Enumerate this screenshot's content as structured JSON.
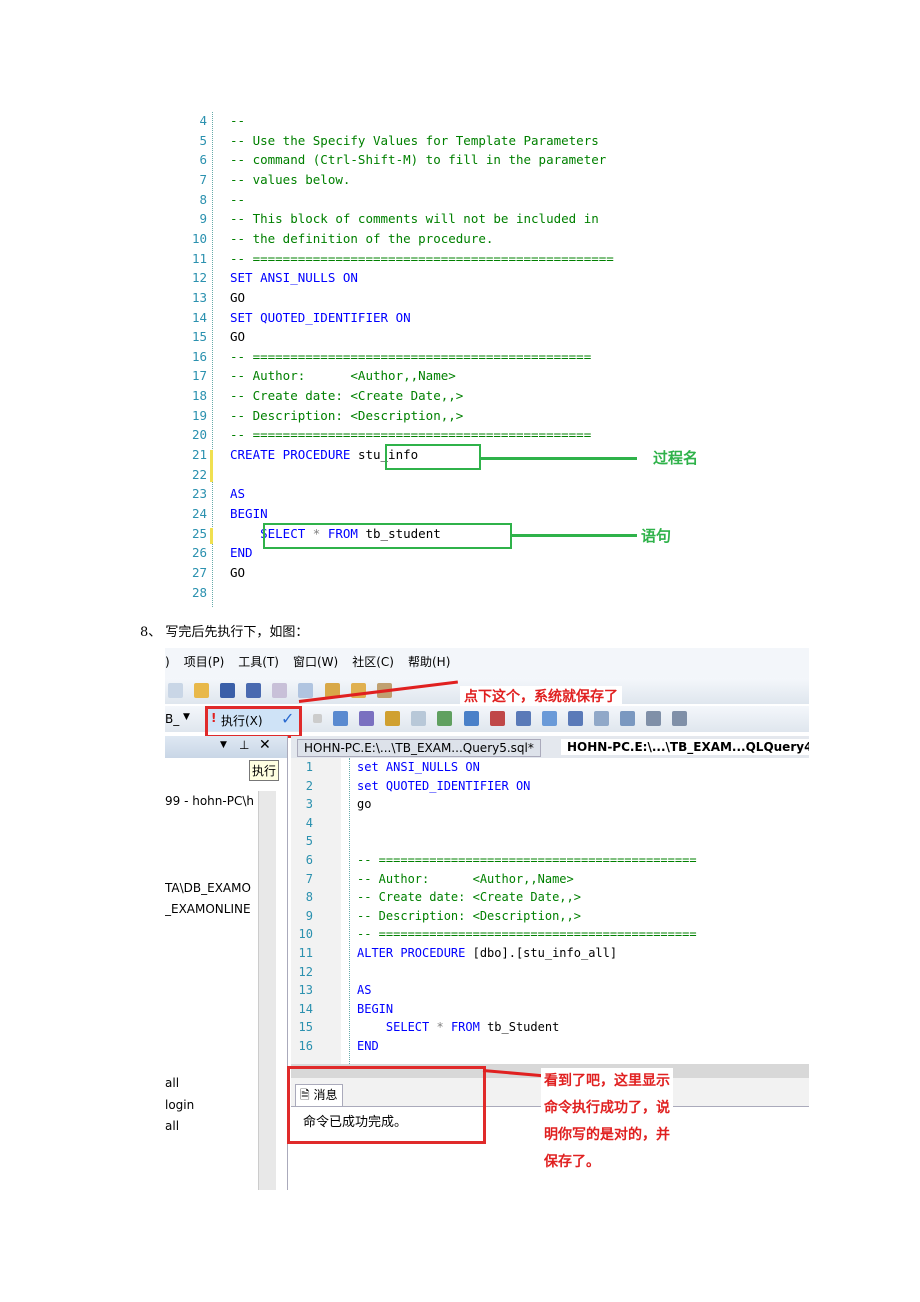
{
  "top_code": {
    "lines": [
      {
        "n": "4",
        "s": [
          {
            "t": "--",
            "c": "c"
          }
        ]
      },
      {
        "n": "5",
        "s": [
          {
            "t": "-- Use the Specify Values for Template Parameters",
            "c": "c"
          }
        ]
      },
      {
        "n": "6",
        "s": [
          {
            "t": "-- command (Ctrl-Shift-M) to fill in the parameter",
            "c": "c"
          }
        ]
      },
      {
        "n": "7",
        "s": [
          {
            "t": "-- values below.",
            "c": "c"
          }
        ]
      },
      {
        "n": "8",
        "s": [
          {
            "t": "--",
            "c": "c"
          }
        ]
      },
      {
        "n": "9",
        "s": [
          {
            "t": "-- This block of comments will not be included in",
            "c": "c"
          }
        ]
      },
      {
        "n": "10",
        "s": [
          {
            "t": "-- the definition of the procedure.",
            "c": "c"
          }
        ]
      },
      {
        "n": "11",
        "s": [
          {
            "t": "-- ================================================",
            "c": "c"
          }
        ]
      },
      {
        "n": "12",
        "s": [
          {
            "t": "SET ANSI_NULLS ON",
            "c": "k"
          }
        ]
      },
      {
        "n": "13",
        "s": [
          {
            "t": "GO",
            "c": "t"
          }
        ]
      },
      {
        "n": "14",
        "s": [
          {
            "t": "SET QUOTED_IDENTIFIER ON",
            "c": "k"
          }
        ]
      },
      {
        "n": "15",
        "s": [
          {
            "t": "GO",
            "c": "t"
          }
        ]
      },
      {
        "n": "16",
        "s": [
          {
            "t": "-- =============================================",
            "c": "c"
          }
        ]
      },
      {
        "n": "17",
        "s": [
          {
            "t": "-- Author:      <Author,,Name>",
            "c": "c"
          }
        ]
      },
      {
        "n": "18",
        "s": [
          {
            "t": "-- Create date: <Create Date,,>",
            "c": "c"
          }
        ]
      },
      {
        "n": "19",
        "s": [
          {
            "t": "-- Description: <Description,,>",
            "c": "c"
          }
        ]
      },
      {
        "n": "20",
        "s": [
          {
            "t": "-- =============================================",
            "c": "c"
          }
        ]
      },
      {
        "n": "21",
        "s": [
          {
            "t": "CREATE PROCEDURE ",
            "c": "k"
          },
          {
            "t": "stu_info",
            "c": "t"
          }
        ]
      },
      {
        "n": "22",
        "s": []
      },
      {
        "n": "23",
        "s": [
          {
            "t": "AS",
            "c": "k"
          }
        ]
      },
      {
        "n": "24",
        "s": [
          {
            "t": "BEGIN",
            "c": "k"
          }
        ]
      },
      {
        "n": "25",
        "s": [
          {
            "t": "    SELECT ",
            "c": "k"
          },
          {
            "t": "* ",
            "c": "g"
          },
          {
            "t": "FROM ",
            "c": "k"
          },
          {
            "t": "tb_student",
            "c": "t"
          }
        ]
      },
      {
        "n": "26",
        "s": [
          {
            "t": "END",
            "c": "k"
          }
        ]
      },
      {
        "n": "27",
        "s": [
          {
            "t": "GO",
            "c": "t"
          }
        ]
      },
      {
        "n": "28",
        "s": []
      }
    ],
    "annotation_proc_name": "过程名",
    "annotation_statement": "语句"
  },
  "step_text": "8、 写完后先执行下，如图：",
  "ide": {
    "menu": [
      ")",
      "项目(P)",
      "工具(T)",
      "窗口(W)",
      "社区(C)",
      "帮助(H)"
    ],
    "db_selector": "B_",
    "execute_button": "执行(X)",
    "tooltip": "执行",
    "annotation_save": "点下这个，系统就保存了",
    "tabs": [
      "HOHN-PC.E:\\...\\TB_EXAM...Query5.sql*",
      "HOHN-PC.E:\\...\\TB_EXAM...QLQuery4."
    ],
    "left_panel": [
      "99 - hohn-PC\\h",
      "TA\\DB_EXAMO",
      "_EXAMONLINE",
      "all",
      "login",
      "all"
    ],
    "code": [
      {
        "n": "1",
        "s": [
          {
            "t": "set ANSI_NULLS ON",
            "c": "k"
          }
        ]
      },
      {
        "n": "2",
        "s": [
          {
            "t": "set QUOTED_IDENTIFIER ON",
            "c": "k"
          }
        ]
      },
      {
        "n": "3",
        "s": [
          {
            "t": "go",
            "c": "t"
          }
        ]
      },
      {
        "n": "4",
        "s": []
      },
      {
        "n": "5",
        "s": []
      },
      {
        "n": "6",
        "s": [
          {
            "t": "-- ============================================",
            "c": "c"
          }
        ]
      },
      {
        "n": "7",
        "s": [
          {
            "t": "-- Author:      <Author,,Name>",
            "c": "c"
          }
        ]
      },
      {
        "n": "8",
        "s": [
          {
            "t": "-- Create date: <Create Date,,>",
            "c": "c"
          }
        ]
      },
      {
        "n": "9",
        "s": [
          {
            "t": "-- Description: <Description,,>",
            "c": "c"
          }
        ]
      },
      {
        "n": "10",
        "s": [
          {
            "t": "-- ============================================",
            "c": "c"
          }
        ]
      },
      {
        "n": "11",
        "s": [
          {
            "t": "ALTER PROCEDURE ",
            "c": "k"
          },
          {
            "t": "[dbo].[stu_info_all]",
            "c": "t"
          }
        ]
      },
      {
        "n": "12",
        "s": []
      },
      {
        "n": "13",
        "s": [
          {
            "t": "AS",
            "c": "k"
          }
        ]
      },
      {
        "n": "14",
        "s": [
          {
            "t": "BEGIN",
            "c": "k"
          }
        ]
      },
      {
        "n": "15",
        "s": [
          {
            "t": "    SELECT ",
            "c": "k"
          },
          {
            "t": "* ",
            "c": "g"
          },
          {
            "t": "FROM ",
            "c": "k"
          },
          {
            "t": "tb_Student",
            "c": "t"
          }
        ]
      },
      {
        "n": "16",
        "s": [
          {
            "t": "END",
            "c": "k"
          }
        ]
      }
    ],
    "messages_tab": "消息",
    "message": "命令已成功完成。",
    "annotation_result": [
      "看到了吧，这里显示",
      "命令执行成功了，说",
      "明你写的是对的，并",
      "保存了。"
    ]
  },
  "colors": {
    "annotation_red": "#e02020",
    "annotation_green": "#2fb24a",
    "keyword": "#0000ff",
    "comment": "#008000",
    "line_number": "#2b91af"
  }
}
